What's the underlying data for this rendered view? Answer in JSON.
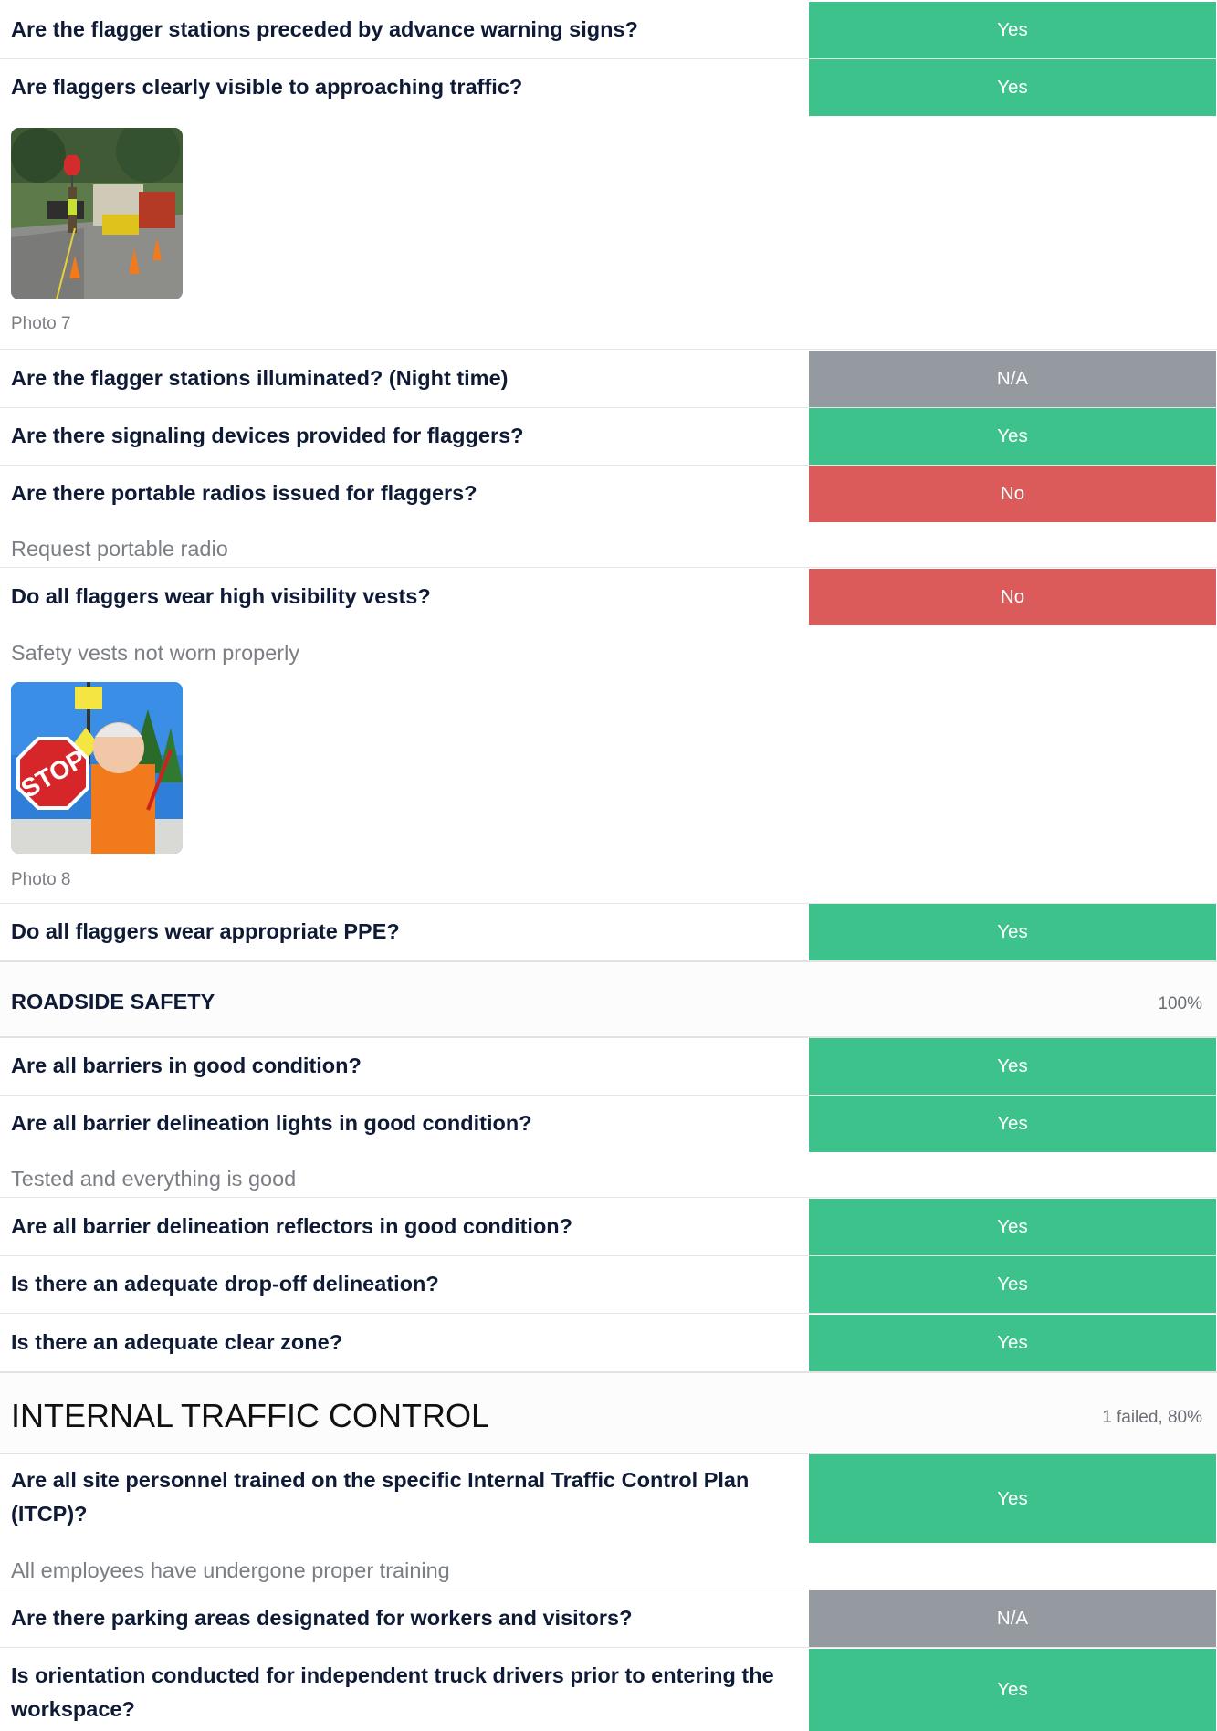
{
  "flaggers": {
    "q_advance_warning": "Are the flagger stations preceded by advance warning signs?",
    "r_advance_warning": "Yes",
    "q_visible": "Are flaggers clearly visible to approaching traffic?",
    "r_visible": "Yes",
    "photo7_caption": "Photo 7",
    "q_illuminated": "Are the flagger stations illuminated? (Night time)",
    "r_illuminated": "N/A",
    "q_signaling": "Are there signaling devices provided for flaggers?",
    "r_signaling": "Yes",
    "q_radios": "Are there portable radios issued for flaggers?",
    "r_radios": "No",
    "note_radios": "Request portable radio",
    "q_vests": "Do all flaggers wear high visibility vests?",
    "r_vests": "No",
    "note_vests": "Safety vests not worn properly",
    "photo8_caption": "Photo 8",
    "photo8_sign_text": "STOP",
    "q_ppe": "Do all flaggers wear appropriate PPE?",
    "r_ppe": "Yes"
  },
  "roadside": {
    "title": "ROADSIDE SAFETY",
    "score": "100%",
    "q_barriers": "Are all barriers in good condition?",
    "r_barriers": "Yes",
    "q_lights": "Are all barrier delineation lights in good condition?",
    "r_lights": "Yes",
    "note_lights": "Tested and everything is good",
    "q_reflectors": "Are all barrier delineation reflectors in good condition?",
    "r_reflectors": "Yes",
    "q_dropoff": "Is there an adequate drop-off delineation?",
    "r_dropoff": "Yes",
    "q_clearzone": "Is there an adequate clear zone?",
    "r_clearzone": "Yes"
  },
  "internal": {
    "title": "INTERNAL TRAFFIC CONTROL",
    "score": "1 failed, 80%",
    "q_trained": "Are all site personnel trained on the specific Internal Traffic Control Plan (ITCP)?",
    "r_trained": "Yes",
    "note_trained": "All employees have undergone proper training",
    "q_parking": "Are there parking areas designated for workers and visitors?",
    "r_parking": "N/A",
    "q_orientation": "Is orientation conducted for independent truck drivers prior to entering the workspace?",
    "r_orientation": "Yes"
  },
  "colors": {
    "yes": "#3ec28c",
    "no": "#db5b5b",
    "na": "#959aa1",
    "question_text": "#0f1b36",
    "note_text": "#7b7f85"
  }
}
